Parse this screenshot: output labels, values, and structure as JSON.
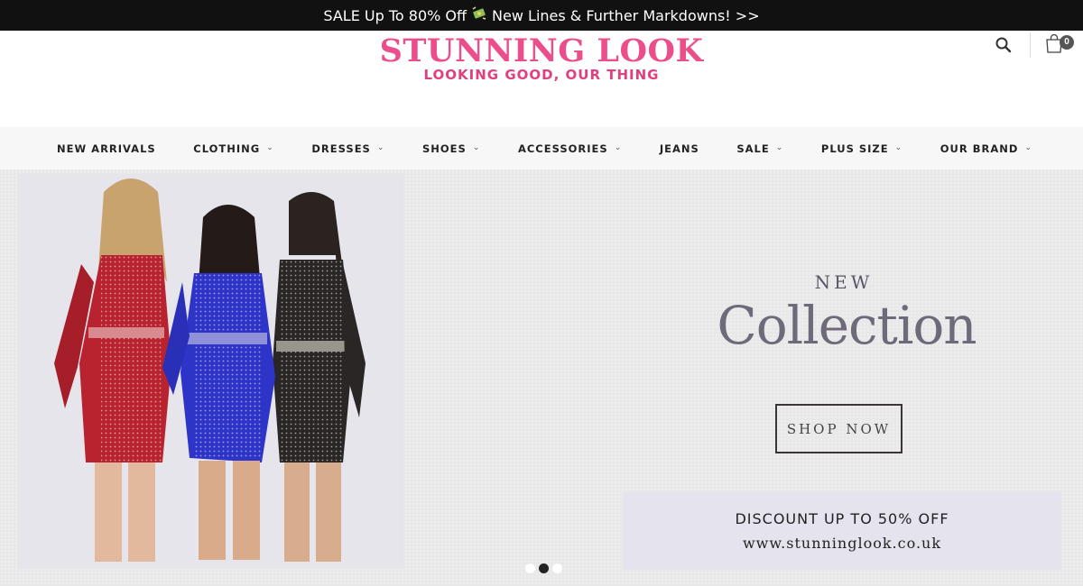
{
  "announcement": {
    "text_before": "SALE Up To 80% Off",
    "icon": "money-with-wings-icon",
    "text_after": "New Lines & Further Markdowns! >>"
  },
  "header": {
    "logo_title": "STUNNING LOOK",
    "logo_tagline": "LOOKING GOOD, OUR THING",
    "cart_count": "0",
    "icons": [
      "search-icon",
      "shopping-bag-icon"
    ]
  },
  "nav": {
    "items": [
      {
        "label": "NEW ARRIVALS",
        "dropdown": false
      },
      {
        "label": "CLOTHING",
        "dropdown": true
      },
      {
        "label": "DRESSES",
        "dropdown": true
      },
      {
        "label": "SHOES",
        "dropdown": true
      },
      {
        "label": "ACCESSORIES",
        "dropdown": true
      },
      {
        "label": "JEANS",
        "dropdown": false
      },
      {
        "label": "SALE",
        "dropdown": true
      },
      {
        "label": "PLUS SIZE",
        "dropdown": true
      },
      {
        "label": "OUR BRAND",
        "dropdown": true
      }
    ]
  },
  "hero": {
    "kicker": "NEW",
    "title": "Collection",
    "cta_label": "SHOP NOW",
    "promo_line1": "DISCOUNT UP TO 50% OFF",
    "promo_line2": "www.stunninglook.co.uk",
    "slides": 3,
    "active_slide": 2
  },
  "colors": {
    "brand_pink": "#ec4d8b",
    "topbar_bg": "#111111",
    "hero_bg": "#e9e8e9",
    "dress_red": "#b8232f",
    "dress_blue": "#2f34c9",
    "dress_black": "#2a2626"
  }
}
